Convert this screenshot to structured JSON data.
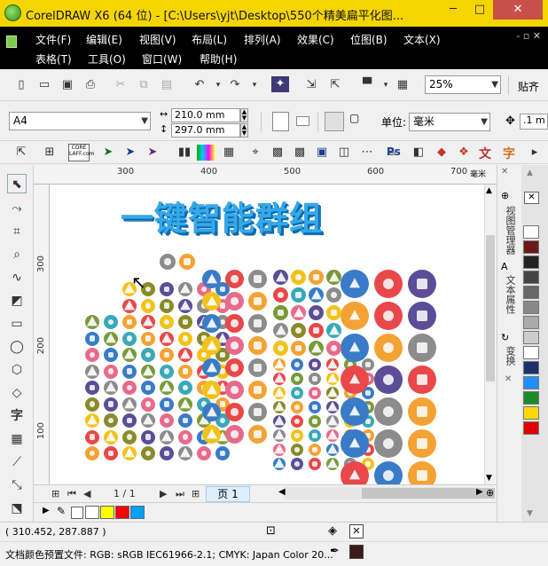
{
  "window": {
    "title": "CorelDRAW X6 (64 位) - [C:\\Users\\yjt\\Desktop\\550个精美扁平化图...",
    "min": "─",
    "max": "□",
    "close": "✕"
  },
  "menu": {
    "row1": [
      "文件(F)",
      "编辑(E)",
      "视图(V)",
      "布局(L)",
      "排列(A)",
      "效果(C)",
      "位图(B)",
      "文本(X)"
    ],
    "row2": [
      "表格(T)",
      "工具(O)",
      "窗口(W)",
      "帮助(H)"
    ],
    "doc_close": "- ▫ ✕"
  },
  "standard_toolbar": {
    "zoom_value": "25%",
    "paste_label": "贴齐"
  },
  "property_bar": {
    "page_size": "A4",
    "width": "210.0 mm",
    "height": "297.0 mm",
    "units_label": "单位:",
    "units_value": "毫米",
    "nudge_value": ".1 m"
  },
  "icon_bar": {
    "core_label": "CORE\nLAFF.com",
    "ps_label": "Ps",
    "text_label": "文",
    "char_label": "字"
  },
  "rulers": {
    "h_numbers": [
      "300",
      "400",
      "500",
      "600",
      "700"
    ],
    "v_numbers": [
      "300",
      "200",
      "100"
    ],
    "unit": "毫米"
  },
  "canvas": {
    "headline": "一键智能群组",
    "colors": {
      "blue": "#3a7bc8",
      "orange": "#f4a234",
      "purple": "#5b4e96",
      "red": "#e8484a",
      "green": "#7a9a3a",
      "gray": "#8c8c8c",
      "yellow": "#f2c21a",
      "teal": "#3aa8b8",
      "pink": "#e86a8a",
      "olive": "#8a8a2a"
    }
  },
  "page_nav": {
    "counter": "1 / 1",
    "tab": "页 1"
  },
  "docker": {
    "tab1": "视图管理器",
    "tab2": "文本属性",
    "tab3": "变换"
  },
  "status": {
    "coords": "( 310.452, 287.887 )",
    "color_profile": "文档颜色预置文件: RGB: sRGB IEC61966-2.1; CMYK: Japan Color 20..."
  },
  "palette_swatches": [
    "#ffffff",
    "#ffff00",
    "#ff0000",
    "#00a0ff"
  ],
  "right_palette": [
    "#ffffff",
    "#6b1a1a",
    "#222222",
    "#444444",
    "#666666",
    "#888888",
    "#aaaaaa",
    "#cccccc",
    "#ffffff",
    "#1e2f6e",
    "#1e90ff",
    "#1a8a2a",
    "#ffd800",
    "#e00000"
  ]
}
